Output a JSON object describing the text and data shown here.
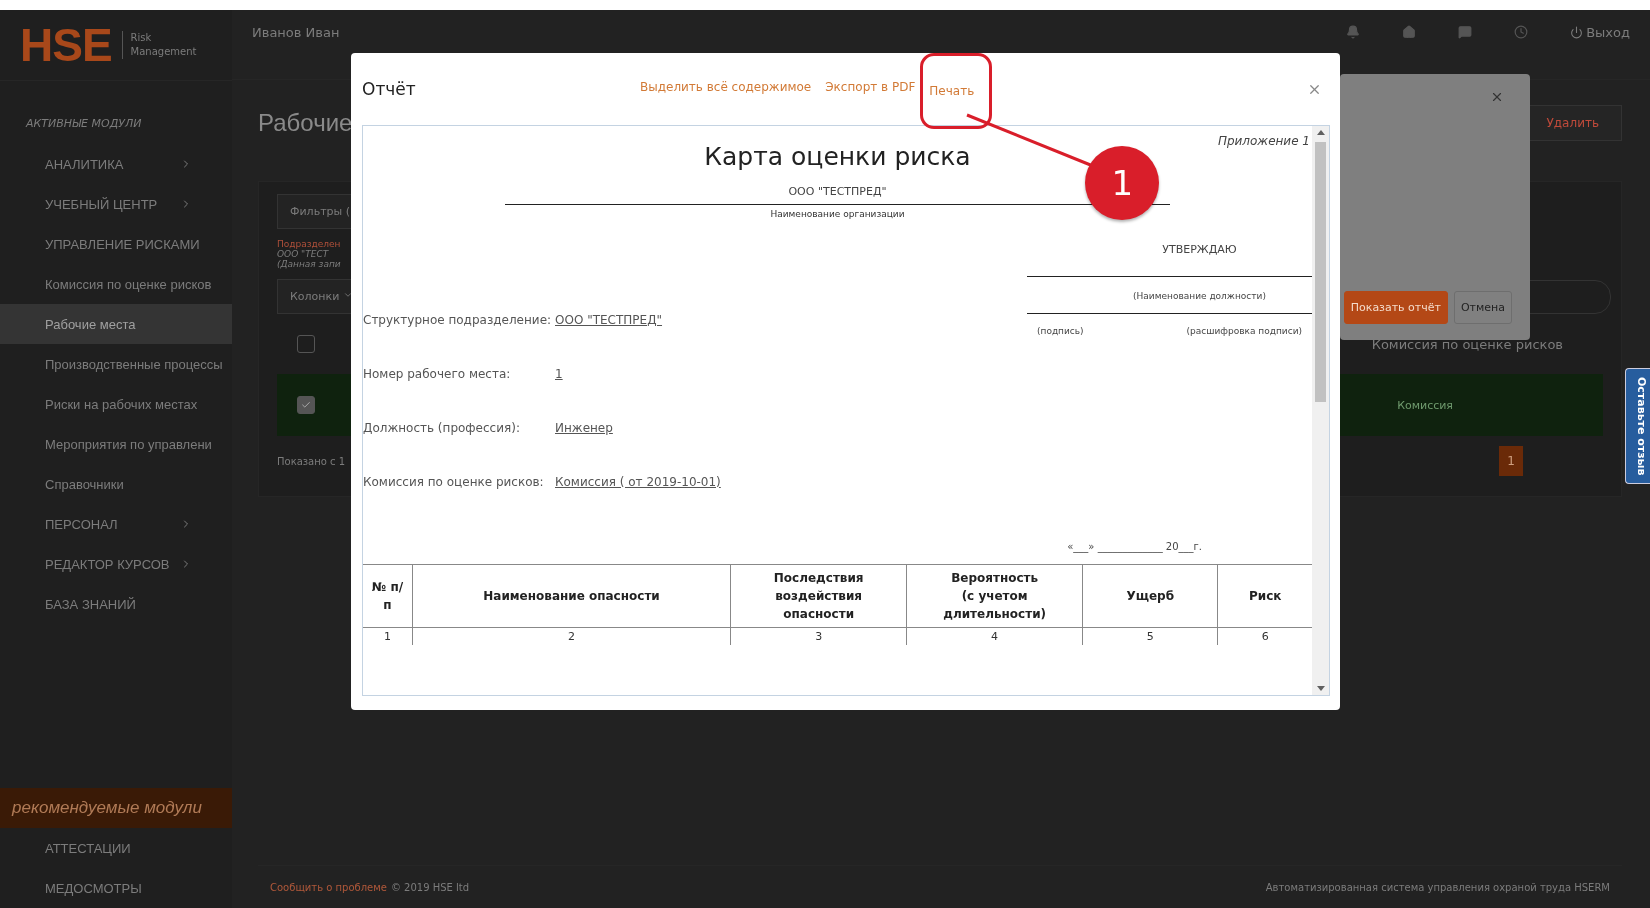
{
  "sidebar": {
    "logo": "HSE",
    "logo_subtitle": "Risk Management",
    "section_title": "АКТИВНЫЕ МОДУЛИ",
    "items": [
      {
        "kind": "group",
        "label": "АНАЛИТИКА",
        "expanded": false
      },
      {
        "kind": "group",
        "label": "УЧЕБНЫЙ ЦЕНТР",
        "expanded": false
      },
      {
        "kind": "group",
        "label": "УПРАВЛЕНИЕ РИСКАМИ",
        "expanded": true,
        "children": [
          {
            "label": "Комиссия по оценке рисков",
            "selected": false
          },
          {
            "label": "Рабочие места",
            "selected": true
          },
          {
            "label": "Производственные процессы",
            "selected": false
          },
          {
            "label": "Риски на рабочих местах",
            "selected": false
          },
          {
            "label": "Мероприятия по управлени",
            "selected": false
          },
          {
            "label": "Справочники",
            "selected": false
          }
        ]
      },
      {
        "kind": "group",
        "label": "ПЕРСОНАЛ",
        "expanded": false
      },
      {
        "kind": "group",
        "label": "РЕДАКТОР КУРСОВ",
        "expanded": false
      },
      {
        "kind": "link",
        "label": "БАЗА ЗНАНИЙ"
      }
    ],
    "recommended_title": "рекомендуемые модули",
    "recommended_items": [
      "АТТЕСТАЦИИ",
      "МЕДОСМОТРЫ"
    ]
  },
  "header": {
    "user_name": "Иванов Иван",
    "logout": "Выход"
  },
  "page": {
    "title": "Рабочие",
    "delete_button": "Удалить",
    "filters": "Фильтры (",
    "filter_note": {
      "label": "Подразделен",
      "value": "ООО \"ТЕСТ",
      "hint": "(Данная запи"
    },
    "columns_button": "Колонки",
    "table": {
      "header_checked": false,
      "column": "Комиссия по оценке рисков",
      "row": {
        "checked": true,
        "cell": "Комиссия"
      }
    },
    "info": "Показано с 1",
    "pager": "1"
  },
  "footer": {
    "report_link": "Сообщить о проблеме",
    "copyright": "© 2019 HSE ltd",
    "system_name": "Автоматизированная система управления охраной труда HSERM"
  },
  "feedback_tab": "Оставьте отзыв",
  "params_dialog": {
    "buttons": [
      {
        "kind": "primary",
        "label": "Показать отчёт"
      },
      {
        "kind": "default",
        "label": "Отмена"
      }
    ]
  },
  "report_dialog": {
    "title": "Отчёт",
    "actions": [
      "Выделить всё содержимое",
      "Экспорт в PDF",
      "Печать"
    ],
    "callout": "1",
    "document": {
      "appendix": "Приложение 1",
      "title": "Карта оценки риска",
      "organization": "ООО \"ТЕСТПРЕД\"",
      "organization_caption": "Наименование организации",
      "approve": "УТВЕРЖДАЮ",
      "position_caption": "(Наименование должности)",
      "signature_caption": "(подпись)",
      "signature_decode_caption": "(расшифровка подписи)",
      "fields": [
        {
          "label": "Структурное подразделение:",
          "value": "ООО \"ТЕСТПРЕД\""
        },
        {
          "label": "Номер рабочего места:",
          "value": "1"
        },
        {
          "label": "Должность (профессия):",
          "value": "Инженер"
        },
        {
          "label": "Комиссия по оценке рисков:",
          "value": "Комиссия ( от 2019-10-01)"
        }
      ],
      "date_line": "«___» _____________ 20___г.",
      "table": {
        "columns": [
          "№ п/п",
          "Наименование опасности",
          "Последствия воздействия\nопасности",
          "Вероятность\n(с учетом длительности)",
          "Ущерб",
          "Риск"
        ],
        "rows": [
          [
            "1",
            "2",
            "3",
            "4",
            "5",
            "6"
          ]
        ]
      }
    }
  }
}
